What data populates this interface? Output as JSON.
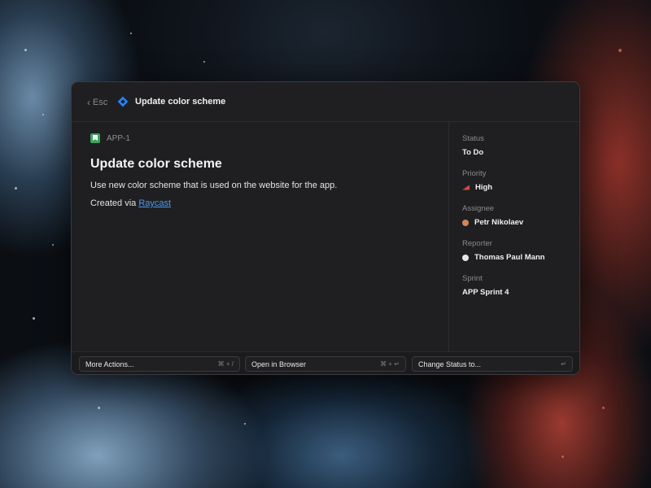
{
  "header": {
    "back_label": "Esc",
    "title": "Update color scheme"
  },
  "issue": {
    "key": "APP-1",
    "title": "Update color scheme",
    "description": "Use new color scheme that is used on the website for the app.",
    "created_prefix": "Created via",
    "created_link": "Raycast"
  },
  "details": {
    "status": {
      "label": "Status",
      "value": "To Do"
    },
    "priority": {
      "label": "Priority",
      "value": "High"
    },
    "assignee": {
      "label": "Assignee",
      "value": "Petr Nikolaev"
    },
    "reporter": {
      "label": "Reporter",
      "value": "Thomas Paul Mann"
    },
    "sprint": {
      "label": "Sprint",
      "value": "APP Sprint 4"
    }
  },
  "actions": [
    {
      "label": "More Actions...",
      "shortcut": "⌘ + /"
    },
    {
      "label": "Open in Browser",
      "shortcut": "⌘ + ↵"
    },
    {
      "label": "Change Status to...",
      "shortcut": "↵"
    }
  ],
  "colors": {
    "accent_link": "#4c9bf3",
    "issue_type": "#3aa35c",
    "priority_high": "#d64a3a",
    "jira_blue": "#2684ff"
  }
}
